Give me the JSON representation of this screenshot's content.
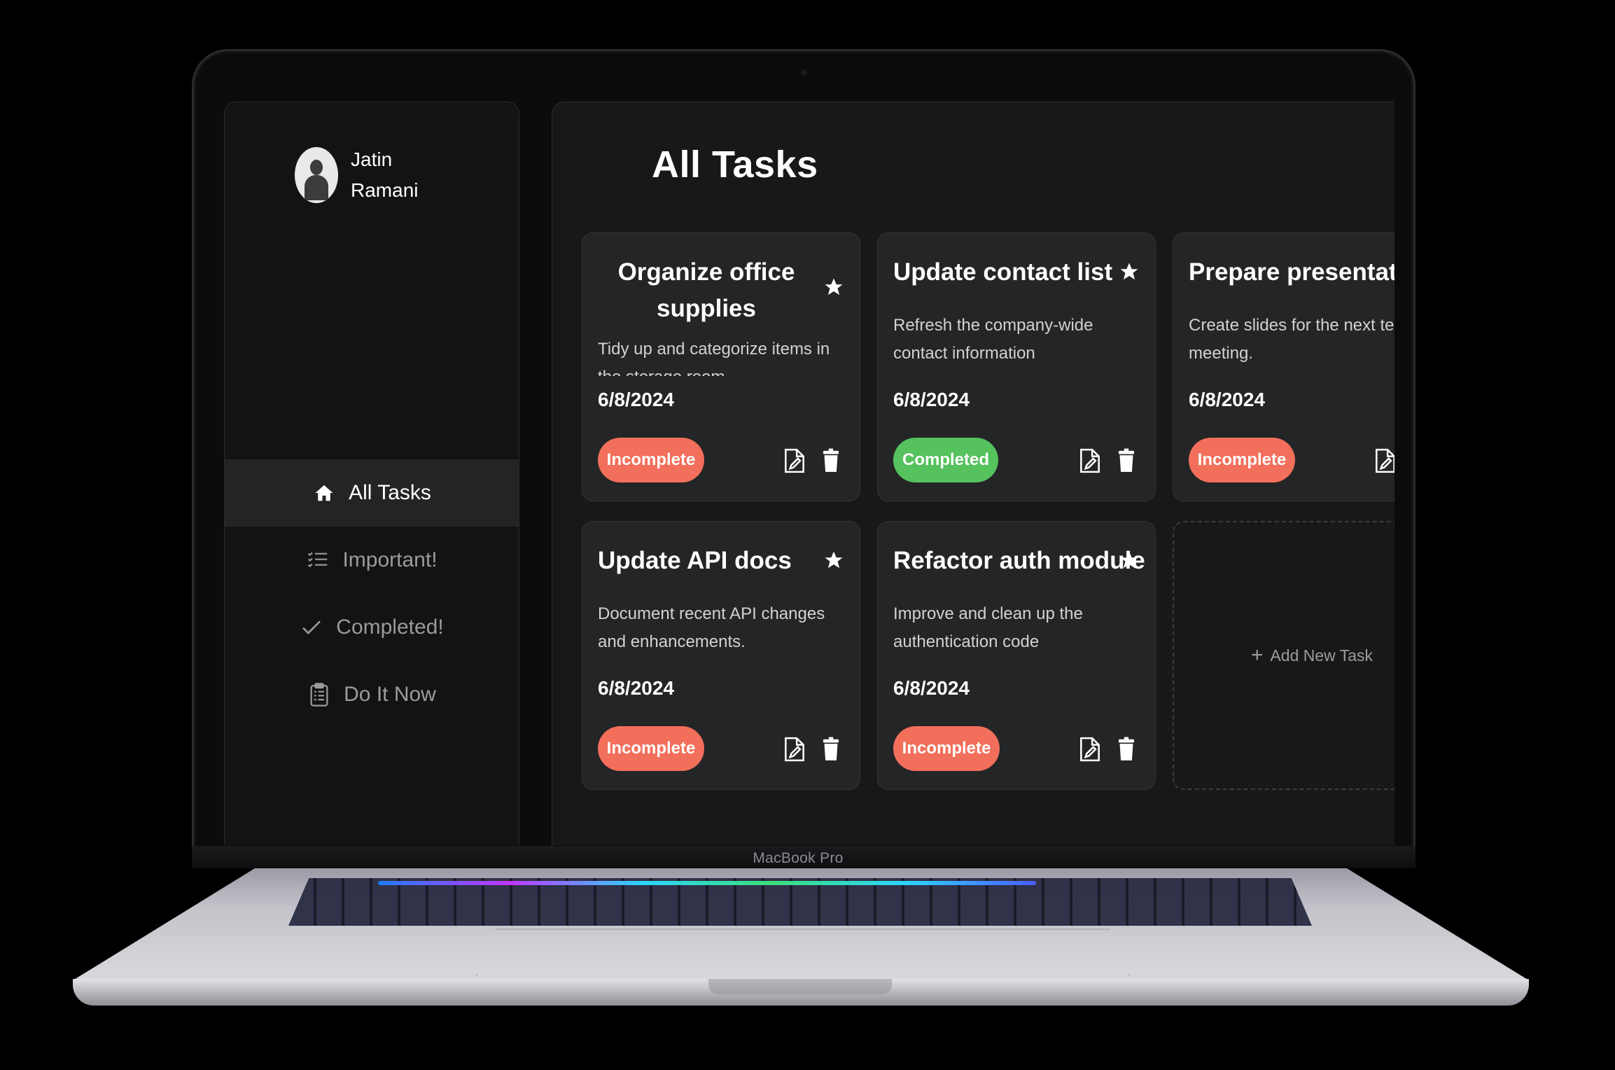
{
  "device": {
    "brand_label": "MacBook Pro"
  },
  "user": {
    "first_name": "Jatin",
    "last_name": "Ramani"
  },
  "nav": {
    "items": [
      {
        "label": "All Tasks",
        "icon": "home-icon",
        "active": true
      },
      {
        "label": "Important!",
        "icon": "checklist-icon",
        "active": false
      },
      {
        "label": "Completed!",
        "icon": "check-icon",
        "active": false
      },
      {
        "label": "Do It Now",
        "icon": "clipboard-icon",
        "active": false
      }
    ]
  },
  "main": {
    "title": "All Tasks",
    "add_task_label": "Add New Task",
    "tasks": [
      {
        "title": "Organize office supplies",
        "description": "Tidy up and categorize items in the storage room",
        "date": "6/8/2024",
        "status": "Incomplete"
      },
      {
        "title": "Update contact list",
        "description": "Refresh the company-wide contact information",
        "date": "6/8/2024",
        "status": "Completed"
      },
      {
        "title": "Prepare presentation",
        "description": "Create slides for the next team meeting.",
        "date": "6/8/2024",
        "status": "Incomplete"
      },
      {
        "title": "Update API docs",
        "description": "Document recent API changes and enhancements.",
        "date": "6/8/2024",
        "status": "Incomplete"
      },
      {
        "title": "Refactor auth module",
        "description": "Improve and clean up the authentication code",
        "date": "6/8/2024",
        "status": "Incomplete"
      }
    ]
  },
  "colors": {
    "incomplete": "#f26f5b",
    "completed": "#55c25d",
    "panel_bg": "#121314",
    "card_bg": "#242526"
  }
}
